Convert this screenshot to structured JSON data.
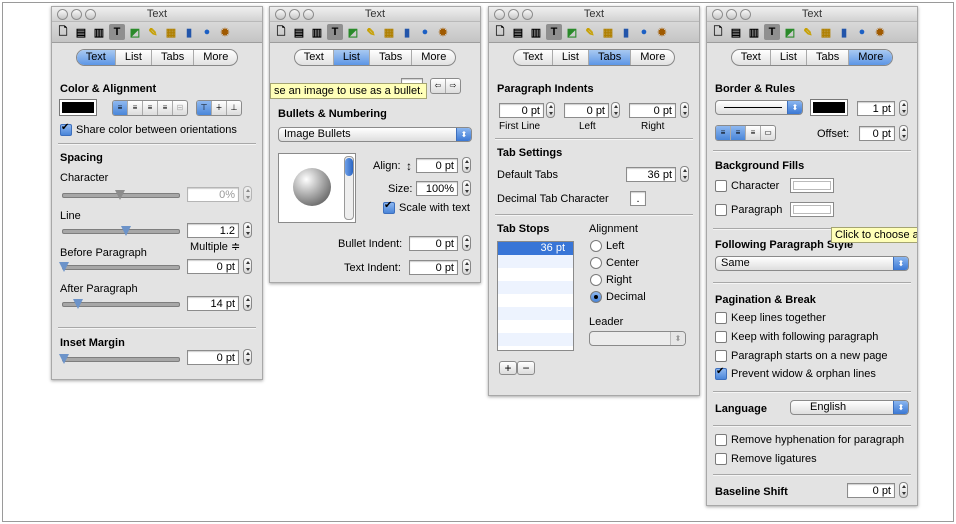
{
  "window_title": "Text",
  "tabs": [
    "Text",
    "List",
    "Tabs",
    "More"
  ],
  "toolbar_icons": [
    "document-icon",
    "layout-icon",
    "wrap-icon",
    "text-icon",
    "graphic-icon",
    "metrics-icon",
    "table-icon",
    "chart-icon",
    "link-icon",
    "quicktime-icon"
  ],
  "panel_text": {
    "color_alignment": "Color & Alignment",
    "share_color": "Share color between orientations",
    "spacing": "Spacing",
    "character": "Character",
    "character_value": "0%",
    "line": "Line",
    "line_value": "1.2",
    "line_mode": "Multiple ≑",
    "before_paragraph": "Before Paragraph",
    "before_value": "0 pt",
    "after_paragraph": "After Paragraph",
    "after_value": "14 pt",
    "inset_margin": "Inset Margin",
    "inset_value": "0 pt"
  },
  "panel_list": {
    "tooltip": "se an image to use as a bullet.",
    "bullets_numbering": "Bullets & Numbering",
    "style_value": "Image Bullets",
    "align_label": "Align:",
    "align_value": "0 pt",
    "size_label": "Size:",
    "size_value": "100%",
    "scale_with_text": "Scale with text",
    "bullet_indent_label": "Bullet Indent:",
    "bullet_indent_value": "0 pt",
    "text_indent_label": "Text Indent:",
    "text_indent_value": "0 pt"
  },
  "panel_tabs": {
    "paragraph_indents": "Paragraph Indents",
    "first_line_value": "0 pt",
    "left_value": "0 pt",
    "right_value": "0 pt",
    "first_line": "First Line",
    "left": "Left",
    "right": "Right",
    "tab_settings": "Tab Settings",
    "default_tabs": "Default Tabs",
    "default_tabs_value": "36 pt",
    "decimal_tab_character": "Decimal Tab Character",
    "decimal_value": ".",
    "tab_stops": "Tab Stops",
    "tab_stop_selected": "36 pt",
    "alignment": "Alignment",
    "align_left": "Left",
    "align_center": "Center",
    "align_right": "Right",
    "align_decimal": "Decimal",
    "leader": "Leader",
    "add": "+",
    "remove": "−"
  },
  "panel_more": {
    "border_rules": "Border & Rules",
    "rule_width_value": "1 pt",
    "offset_label": "Offset:",
    "offset_value": "0 pt",
    "background_fills": "Background Fills",
    "character": "Character",
    "paragraph": "Paragraph",
    "tooltip": "Click to choose a",
    "following_paragraph_style": "Following Paragraph Style",
    "following_value": "Same",
    "pagination_break": "Pagination & Break",
    "keep_lines_together": "Keep lines together",
    "keep_with_following": "Keep with following paragraph",
    "starts_new_page": "Paragraph starts on a new page",
    "prevent_widow": "Prevent widow & orphan lines",
    "language_label": "Language",
    "language_value": "English",
    "remove_hyphenation": "Remove hyphenation for paragraph",
    "remove_ligatures": "Remove ligatures",
    "baseline_shift": "Baseline Shift",
    "baseline_value": "0 pt"
  },
  "colors": {
    "accent": "#5d96e6",
    "panel_bg": "#e3e3e3",
    "tooltip_bg": "#ffffb8"
  }
}
